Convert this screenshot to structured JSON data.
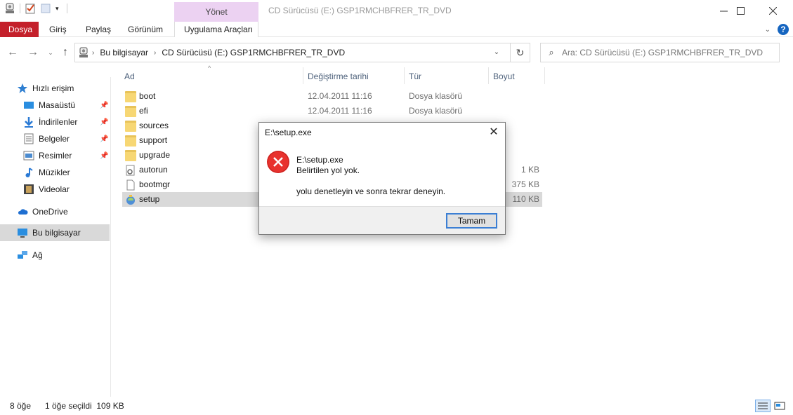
{
  "window": {
    "title": "CD Sürücüsü (E:) GSP1RMCHBFRER_TR_DVD",
    "manage_tab": "Yönet",
    "minimize_icon": "minimize-icon",
    "maximize_icon": "maximize-icon",
    "close_icon": "close-icon"
  },
  "ribbon": {
    "tabs": [
      "Dosya",
      "Giriş",
      "Paylaş",
      "Görünüm",
      "Uygulama Araçları"
    ],
    "file_color": "#c4202b",
    "manage_color": "#ecd2f2"
  },
  "navigation": {
    "breadcrumb": [
      "Bu bilgisayar",
      "CD Sürücüsü (E:) GSP1RMCHBFRER_TR_DVD"
    ],
    "search_placeholder": "Ara: CD Sürücüsü (E:) GSP1RMCHBFRER_TR_DVD"
  },
  "sidebar": {
    "items": [
      {
        "label": "Hızlı erişim",
        "icon": "star-icon"
      },
      {
        "label": "Masaüstü",
        "icon": "desktop-icon",
        "pinned": true
      },
      {
        "label": "İndirilenler",
        "icon": "download-icon",
        "pinned": true
      },
      {
        "label": "Belgeler",
        "icon": "documents-icon",
        "pinned": true
      },
      {
        "label": "Resimler",
        "icon": "pictures-icon",
        "pinned": true
      },
      {
        "label": "Müzikler",
        "icon": "music-icon"
      },
      {
        "label": "Videolar",
        "icon": "video-icon"
      },
      {
        "label": "OneDrive",
        "icon": "cloud-icon"
      },
      {
        "label": "Bu bilgisayar",
        "icon": "computer-icon",
        "selected": true
      },
      {
        "label": "Ağ",
        "icon": "network-icon"
      }
    ]
  },
  "columns": {
    "name": "Ad",
    "modified": "Değiştirme tarihi",
    "type": "Tür",
    "size": "Boyut"
  },
  "files": [
    {
      "name": "boot",
      "date": "12.04.2011 11:16",
      "type": "Dosya klasörü",
      "size": "",
      "icon": "folder-icon"
    },
    {
      "name": "efi",
      "date": "12.04.2011 11:16",
      "type": "Dosya klasörü",
      "size": "",
      "icon": "folder-icon"
    },
    {
      "name": "sources",
      "date": "",
      "type": "",
      "size": "",
      "icon": "folder-icon"
    },
    {
      "name": "support",
      "date": "",
      "type": "",
      "size": "",
      "icon": "folder-icon"
    },
    {
      "name": "upgrade",
      "date": "",
      "type": "",
      "size": "",
      "icon": "folder-icon"
    },
    {
      "name": "autorun",
      "date": "",
      "type": "",
      "size": "1 KB",
      "icon": "settings-file-icon"
    },
    {
      "name": "bootmgr",
      "date": "",
      "type": "",
      "size": "375 KB",
      "icon": "file-icon"
    },
    {
      "name": "setup",
      "date": "",
      "type": "",
      "size": "110 KB",
      "icon": "setup-icon",
      "selected": true
    }
  ],
  "status": {
    "count": "8 öğe",
    "selection": "1 öğe seçildi  109 KB"
  },
  "dialog": {
    "title": "E:\\setup.exe",
    "line1": "E:\\setup.exe",
    "line2": "Belirtilen yol yok.",
    "line3": "yolu denetleyin ve sonra tekrar deneyin.",
    "ok_label": "Tamam",
    "icon": "error-icon",
    "icon_color": "#e8322e"
  }
}
